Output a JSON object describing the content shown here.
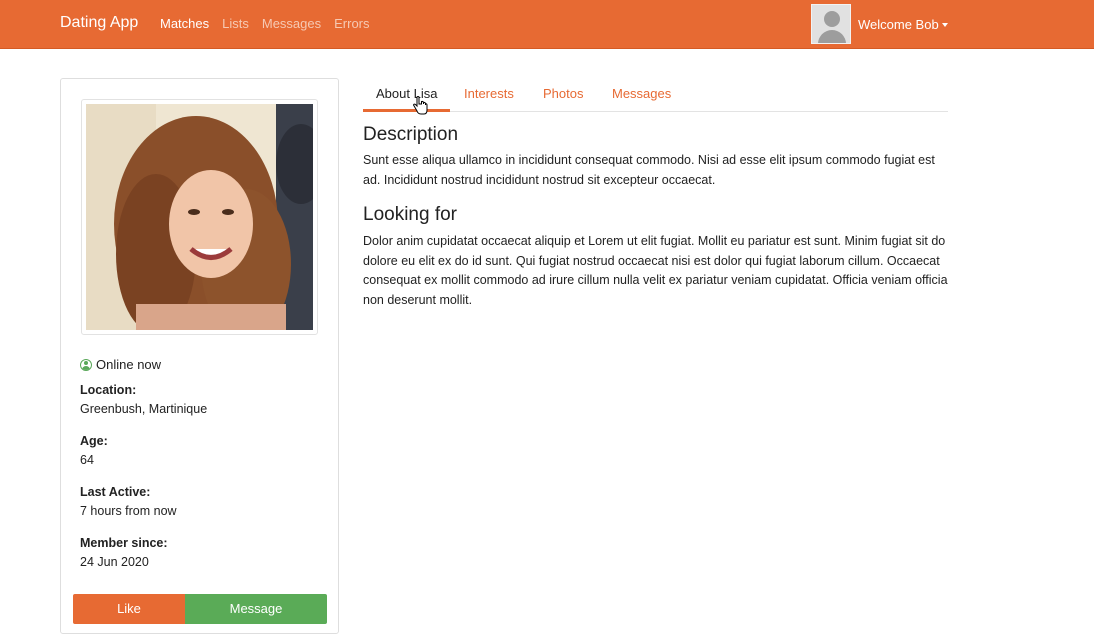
{
  "navbar": {
    "brand": "Dating App",
    "links": [
      {
        "label": "Matches",
        "active": true
      },
      {
        "label": "Lists",
        "active": false
      },
      {
        "label": "Messages",
        "active": false
      },
      {
        "label": "Errors",
        "active": false
      }
    ],
    "welcome": "Welcome Bob",
    "accent_color": "#e76a33"
  },
  "profile": {
    "status": "Online now",
    "fields": [
      {
        "label": "Location:",
        "value": "Greenbush, Martinique"
      },
      {
        "label": "Age:",
        "value": "64"
      },
      {
        "label": "Last Active:",
        "value": "7 hours from now"
      },
      {
        "label": "Member since:",
        "value": "24 Jun 2020"
      }
    ],
    "like_label": "Like",
    "message_label": "Message",
    "like_color": "#e76a33",
    "message_color": "#5aab57"
  },
  "tabs": [
    {
      "label": "About Lisa",
      "active": true
    },
    {
      "label": "Interests",
      "active": false
    },
    {
      "label": "Photos",
      "active": false
    },
    {
      "label": "Messages",
      "active": false
    }
  ],
  "about": {
    "description_title": "Description",
    "description_text": "Sunt esse aliqua ullamco in incididunt consequat commodo. Nisi ad esse elit ipsum commodo fugiat est ad. Incididunt nostrud incididunt nostrud sit excepteur occaecat.",
    "looking_for_title": "Looking for",
    "looking_for_text": "Dolor anim cupidatat occaecat aliquip et Lorem ut elit fugiat. Mollit eu pariatur est sunt. Minim fugiat sit do dolore eu elit ex do id sunt. Qui fugiat nostrud occaecat nisi est dolor qui fugiat laborum cillum. Occaecat consequat ex mollit commodo ad irure cillum nulla velit ex pariatur veniam cupidatat. Officia veniam officia non deserunt mollit."
  }
}
